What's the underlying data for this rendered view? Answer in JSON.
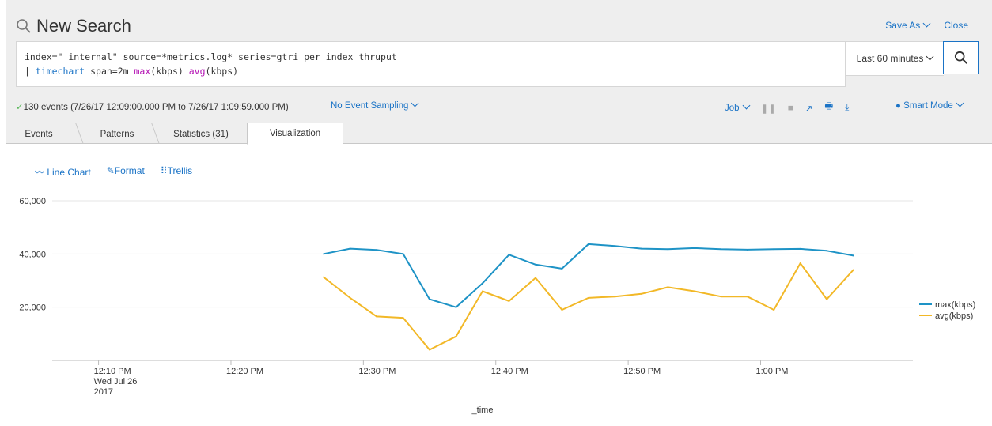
{
  "header": {
    "title": "New Search",
    "save_as": "Save As",
    "close": "Close"
  },
  "search": {
    "line1": "index=\"_internal\" source=*metrics.log* series=gtri per_index_thruput",
    "line2_pipe": "| ",
    "line2_cmd": "timechart",
    "line2_span": " span=2m ",
    "line2_fn1": "max",
    "line2_arg1": "(kbps) ",
    "line2_fn2": "avg",
    "line2_arg2": "(kbps)",
    "time_range": "Last 60 minutes"
  },
  "status": {
    "events": "130 events (7/26/17 12:09:00.000 PM to 7/26/17 1:09:59.000 PM)",
    "sampling": "No Event Sampling",
    "job": "Job",
    "mode": "Smart Mode"
  },
  "tabs": [
    {
      "label": "Events"
    },
    {
      "label": "Patterns"
    },
    {
      "label": "Statistics (31)"
    },
    {
      "label": "Visualization"
    }
  ],
  "viz_toolbar": {
    "line_chart": "Line Chart",
    "format": "Format",
    "trellis": "Trellis"
  },
  "chart_data": {
    "type": "line",
    "xlabel": "_time",
    "x_ticks": [
      {
        "t": 10,
        "label": [
          "12:10 PM",
          "Wed Jul 26",
          "2017"
        ]
      },
      {
        "t": 20,
        "label": [
          "12:20 PM"
        ]
      },
      {
        "t": 30,
        "label": [
          "12:30 PM"
        ]
      },
      {
        "t": 40,
        "label": [
          "12:40 PM"
        ]
      },
      {
        "t": 50,
        "label": [
          "12:50 PM"
        ]
      },
      {
        "t": 60,
        "label": [
          "1:00 PM"
        ]
      }
    ],
    "x_times": [
      "12:27 PM",
      "12:29 PM",
      "12:31 PM",
      "12:33 PM",
      "12:35 PM",
      "12:37 PM",
      "12:39 PM",
      "12:41 PM",
      "12:43 PM",
      "12:45 PM",
      "12:47 PM",
      "12:49 PM",
      "12:51 PM",
      "12:53 PM",
      "12:55 PM",
      "12:57 PM",
      "12:59 PM",
      "1:01 PM",
      "1:03 PM",
      "1:05 PM",
      "1:07 PM"
    ],
    "x_minutes": [
      27,
      29,
      31,
      33,
      35,
      37,
      39,
      41,
      43,
      45,
      47,
      49,
      51,
      53,
      55,
      57,
      59,
      61,
      63,
      65,
      67
    ],
    "x_range": [
      6.5,
      71.5
    ],
    "y_ticks": [
      20000,
      40000,
      60000
    ],
    "y_tick_labels": [
      "20,000",
      "40,000",
      "60,000"
    ],
    "ylim": [
      0,
      60000
    ],
    "grid": true,
    "legend_position": "right",
    "series": [
      {
        "name": "max(kbps)",
        "color": "#1e93c6",
        "values": [
          40000,
          42000,
          41500,
          40000,
          23000,
          20000,
          29000,
          39700,
          36000,
          34500,
          43700,
          43000,
          42000,
          41800,
          42200,
          41800,
          41600,
          41800,
          41900,
          41200,
          39400
        ]
      },
      {
        "name": "avg(kbps)",
        "color": "#f2b827",
        "values": [
          31300,
          23500,
          16500,
          16000,
          4000,
          9000,
          26000,
          22300,
          31000,
          19000,
          23500,
          24000,
          25000,
          27500,
          26000,
          24000,
          24000,
          19000,
          36500,
          23000,
          34000
        ]
      }
    ]
  }
}
